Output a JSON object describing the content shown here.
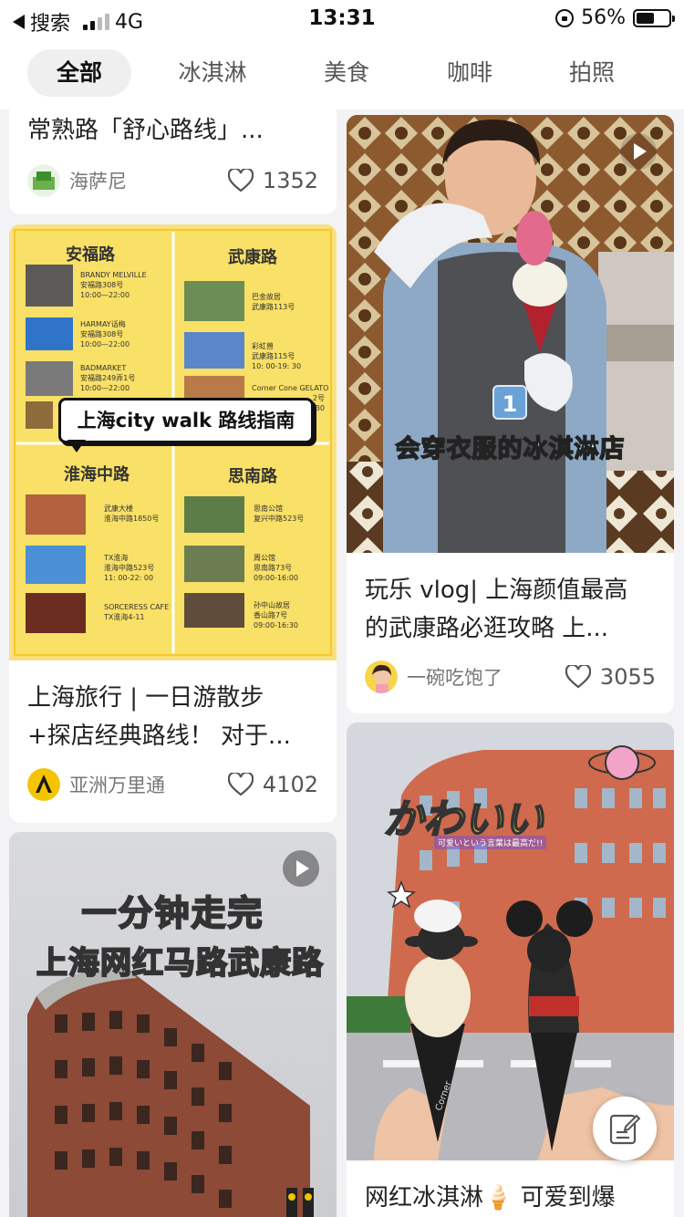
{
  "status_bar": {
    "back_app": "搜索",
    "network": "4G",
    "time": "13:31",
    "battery": "56%",
    "battery_level": 0.56
  },
  "tabs": [
    {
      "label": "全部",
      "active": true
    },
    {
      "label": "冰淇淋",
      "active": false
    },
    {
      "label": "美食",
      "active": false
    },
    {
      "label": "咖啡",
      "active": false
    },
    {
      "label": "拍照",
      "active": false
    }
  ],
  "cards": {
    "c1": {
      "title": "常熟路「舒心路线」...",
      "author": "海萨尼",
      "likes": "1352"
    },
    "c2": {
      "title_line1": "上海旅行 | 一日游散步",
      "title_line2": "+探店经典路线！ 对于...",
      "author": "亚洲万里通",
      "likes": "4102",
      "img": {
        "banner": "上海city walk 路线指南",
        "q1": "安福路",
        "q2": "武康路",
        "q3": "淮海中路",
        "q4": "思南路",
        "q1_items": [
          {
            "name": "BRANDY MELVILLE",
            "addr": "安福路308号",
            "time": "10:00—22:00"
          },
          {
            "name": "HARMAY话梅",
            "addr": "安福路308号",
            "time": "10:00—22:00"
          },
          {
            "name": "BADMARKET",
            "addr": "安福路249弄1号",
            "time": "10:00—22:00"
          }
        ],
        "q2_items": [
          {
            "name": "巴金故居",
            "addr": "武康路113号"
          },
          {
            "name": "彩虹兽",
            "addr": "武康路115号",
            "time": "10: 00-19: 30"
          },
          {
            "name": "Corner Cone GELATO",
            "addr": "2号",
            "time": "30"
          }
        ],
        "q3_items": [
          {
            "name": "武康大楼",
            "addr": "淮海中路1850号"
          },
          {
            "name": "TX淮海",
            "addr": "淮海中路523号",
            "time": "11: 00-22: 00"
          },
          {
            "name": "SORCERESS CAFE",
            "addr": "TX淮海4-11"
          }
        ],
        "q4_items": [
          {
            "name": "思南公馆",
            "addr": "复兴中路523号"
          },
          {
            "name": "周公馆",
            "addr": "思南路73号",
            "time": "09:00-16:00"
          },
          {
            "name": "孙中山故居",
            "addr": "香山路7号",
            "time": "09:00-16:30"
          }
        ]
      }
    },
    "c3": {
      "overlay_line1": "一分钟走完",
      "overlay_line2a": "上海网红马路",
      "overlay_line2b": "武康路"
    },
    "c4": {
      "title_line1": "玩乐 vlog| 上海颜值最高",
      "title_line2": "的武康路必逛攻略 上...",
      "author": "一碗吃饱了",
      "likes": "3055",
      "img": {
        "badge": "1",
        "caption": "会穿衣服的冰淇淋店"
      }
    },
    "c5": {
      "title": "网红冰淇淋🍦 可爱到爆",
      "img": {
        "kawaii": "かわいい",
        "sub": "可爱いという言葉は最高だ!!",
        "corner": "Corner"
      }
    }
  },
  "colors": {
    "accent_yellow": "#f7dc5c",
    "tab_active_bg": "#efefef",
    "page_bg": "#f3f3f5"
  }
}
